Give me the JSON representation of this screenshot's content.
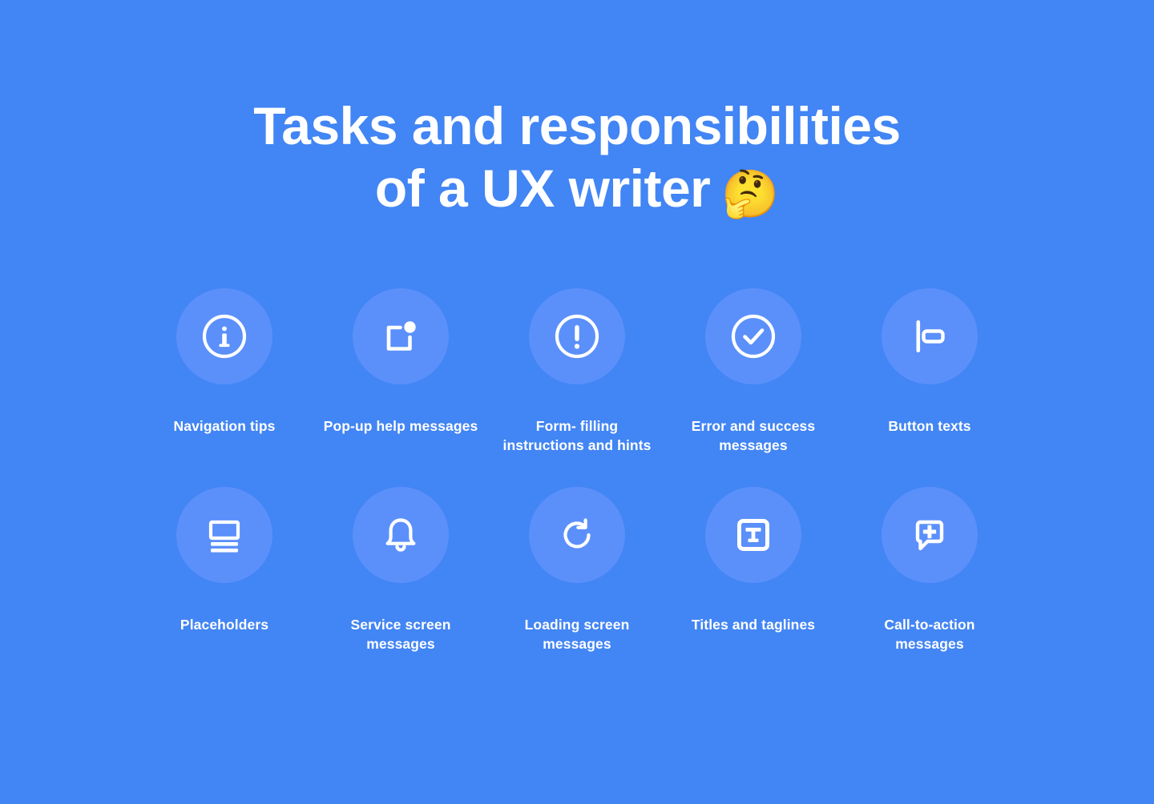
{
  "theme": {
    "background_color": "#4285f4",
    "circle_color": "#5b90fb",
    "text_color": "#ffffff"
  },
  "header": {
    "title_line_1": "Tasks and responsibilities",
    "title_line_2": "of a UX writer",
    "title_emoji": "🤔"
  },
  "grid": {
    "rows": [
      {
        "items": [
          {
            "label": "Navigation tips",
            "icon": "info-circle-icon"
          },
          {
            "label": "Pop-up help messages",
            "icon": "popup-notification-icon"
          },
          {
            "label": "Form- filling instructions and hints",
            "icon": "exclamation-circle-icon"
          },
          {
            "label": "Error and success messages",
            "icon": "check-circle-icon"
          },
          {
            "label": "Button texts",
            "icon": "align-left-button-icon"
          }
        ]
      },
      {
        "items": [
          {
            "label": "Placeholders",
            "icon": "content-placeholder-icon"
          },
          {
            "label": "Service screen messages",
            "icon": "bell-icon"
          },
          {
            "label": "Loading screen messages",
            "icon": "refresh-icon"
          },
          {
            "label": "Titles and taglines",
            "icon": "text-box-icon"
          },
          {
            "label": "Call-to-action messages",
            "icon": "speech-bubble-plus-icon"
          }
        ]
      }
    ]
  }
}
